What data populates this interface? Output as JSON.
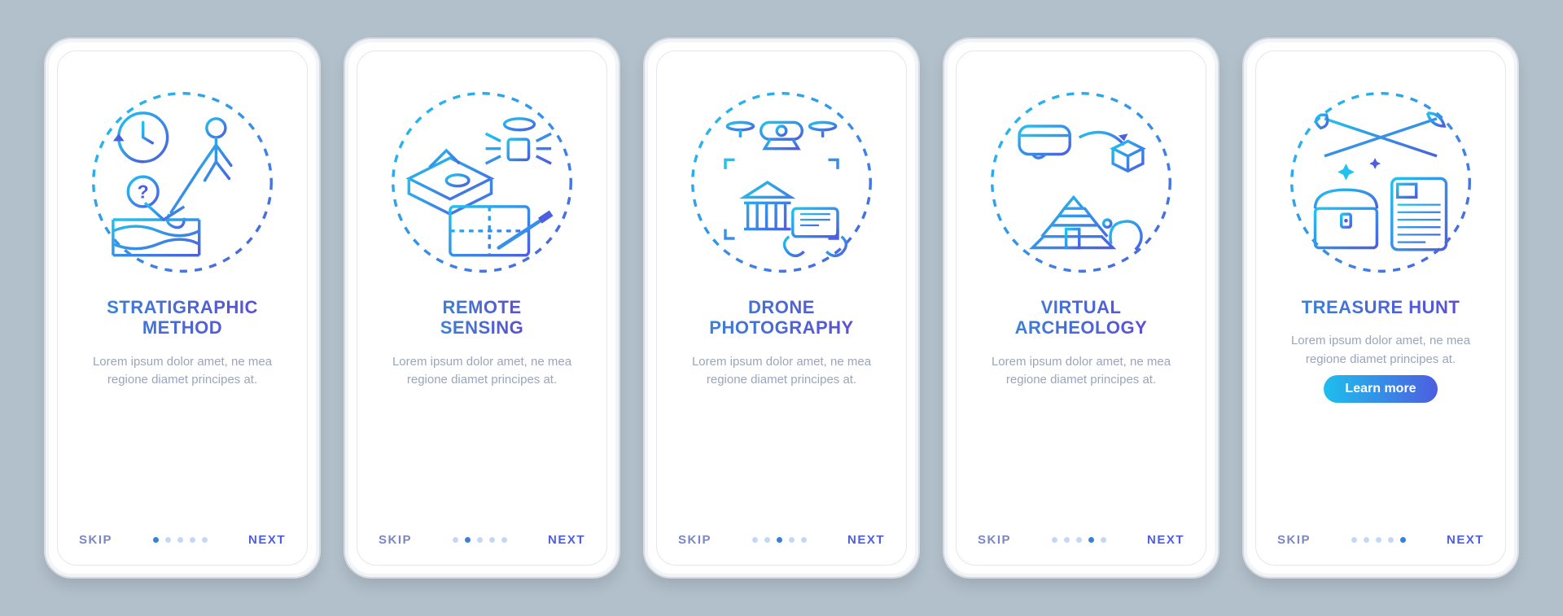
{
  "common": {
    "skip": "SKIP",
    "next": "NEXT",
    "desc": "Lorem ipsum dolor amet, ne mea regione diamet principes at.",
    "total_steps": 5,
    "cta": "Learn more"
  },
  "screens": [
    {
      "title": "Stratigraphic\nmethod",
      "icon": "stratigraphic-icon",
      "step": 1,
      "has_cta": false
    },
    {
      "title": "Remote\nsensing",
      "icon": "remote-sensing-icon",
      "step": 2,
      "has_cta": false
    },
    {
      "title": "Drone\nphotography",
      "icon": "drone-icon",
      "step": 3,
      "has_cta": false
    },
    {
      "title": "Virtual\narcheology",
      "icon": "virtual-arch-icon",
      "step": 4,
      "has_cta": false
    },
    {
      "title": "Treasure hunt",
      "icon": "treasure-icon",
      "step": 5,
      "has_cta": true
    }
  ],
  "colors": {
    "grad_light": "#20c3f0",
    "grad_dark": "#4d5ee0",
    "text_muted": "#9aa5bb"
  }
}
